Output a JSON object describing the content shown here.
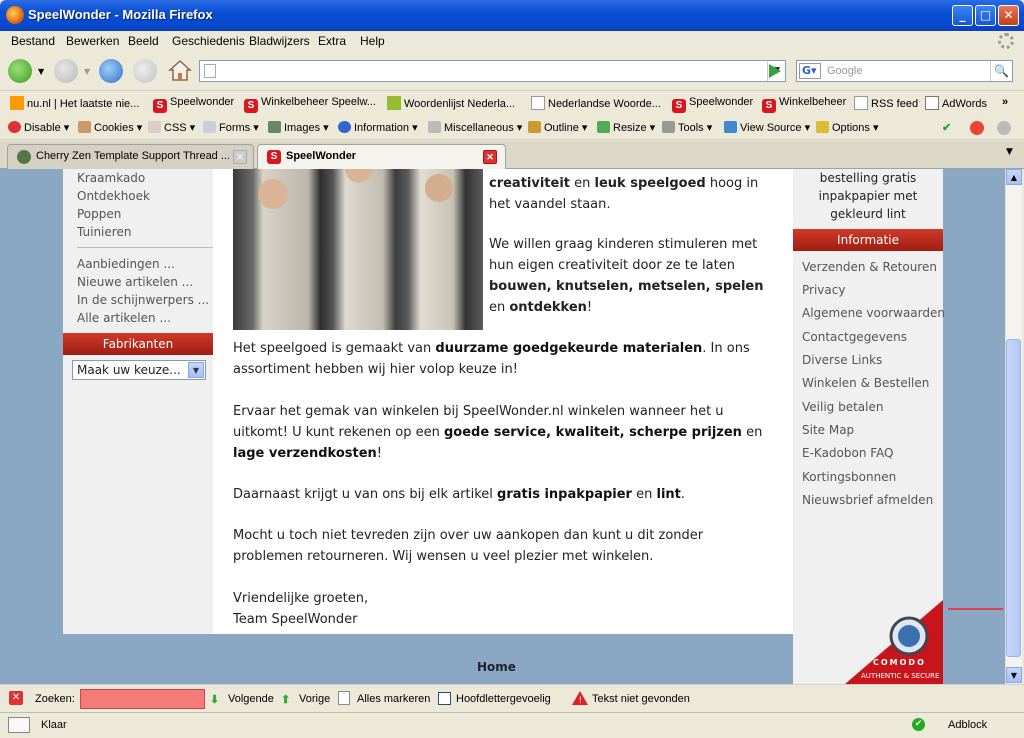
{
  "window": {
    "title": "SpeelWonder - Mozilla Firefox"
  },
  "menu": [
    "Bestand",
    "Bewerken",
    "Beeld",
    "Geschiedenis",
    "Bladwijzers",
    "Extra",
    "Help"
  ],
  "navbar": {
    "url": "",
    "search_placeholder": "Google"
  },
  "bookmarks": [
    "nu.nl | Het laatste nie...",
    "Speelwonder",
    "Winkelbeheer Speelw...",
    "Woordenlijst Nederla...",
    "Nederlandse Woorde...",
    "Speelwonder",
    "Winkelbeheer",
    "RSS feed",
    "AdWords"
  ],
  "webdev": [
    "Disable",
    "Cookies",
    "CSS",
    "Forms",
    "Images",
    "Information",
    "Miscellaneous",
    "Outline",
    "Resize",
    "Tools",
    "View Source",
    "Options"
  ],
  "tabs": [
    {
      "label": "Cherry Zen Template Support Thread ...",
      "active": false
    },
    {
      "label": "SpeelWonder",
      "active": true
    }
  ],
  "left": {
    "top_links": [
      "Kraamkado",
      "Ontdekhoek",
      "Poppen",
      "Tuinieren"
    ],
    "special_links": [
      "Aanbiedingen ...",
      "Nieuwe artikelen ...",
      "In de schijnwerpers ...",
      "Alle artikelen ..."
    ],
    "manufacturers_header": "Fabrikanten",
    "manufacturers_select": "Maak uw keuze..."
  },
  "center": {
    "intro_top": [
      "creativiteit",
      " en ",
      "leuk speelgoed",
      " hoog in het vaandel staan."
    ],
    "p2": [
      "We willen graag kinderen stimuleren met hun eigen creativiteit door ze te laten ",
      "bouwen, knutselen, metselen, spelen",
      " en ",
      "ontdekken",
      "!"
    ],
    "p3": [
      "Het speelgoed is gemaakt van ",
      "duurzame goedgekeurde materialen",
      ". In ons assortiment hebben wij hier volop keuze in!"
    ],
    "p4": [
      "Ervaar het gemak van winkelen bij SpeelWonder.nl winkelen wanneer het u uitkomt! U kunt rekenen op een ",
      "goede service, kwaliteit, scherpe prijzen",
      " en ",
      "lage verzendkosten",
      "!"
    ],
    "p5": [
      "Daarnaast krijgt u van ons bij elk artikel ",
      "gratis inpakpapier",
      " en ",
      "lint",
      "."
    ],
    "p6": "Mocht u toch niet tevreden zijn over uw aankopen dan kunt u dit zonder problemen retourneren. Wij wensen u veel plezier met winkelen.",
    "p7_1": "Vriendelijke groeten,",
    "p7_2": "Team SpeelWonder"
  },
  "right": {
    "promo": "bestelling gratis inpakpapier met gekleurd lint",
    "info_header": "Informatie",
    "info_links": [
      "Verzenden & Retouren",
      "Privacy",
      "Algemene voorwaarden",
      "Contactgegevens",
      "Diverse Links",
      "Winkelen & Bestellen",
      "Veilig betalen",
      "Site Map",
      "E-Kadobon FAQ",
      "Kortingsbonnen",
      "Nieuwsbrief afmelden"
    ]
  },
  "footer": {
    "home": "Home"
  },
  "comodo": {
    "brand": "COMODO",
    "tagline": "AUTHENTIC & SECURE"
  },
  "findbar": {
    "label": "Zoeken:",
    "next": "Volgende",
    "prev": "Vorige",
    "highlight": "Alles markeren",
    "match_case": "Hoofdlettergevoelig",
    "status": "Tekst niet gevonden"
  },
  "statusbar": {
    "text": "Klaar",
    "adblock": "Adblock"
  }
}
